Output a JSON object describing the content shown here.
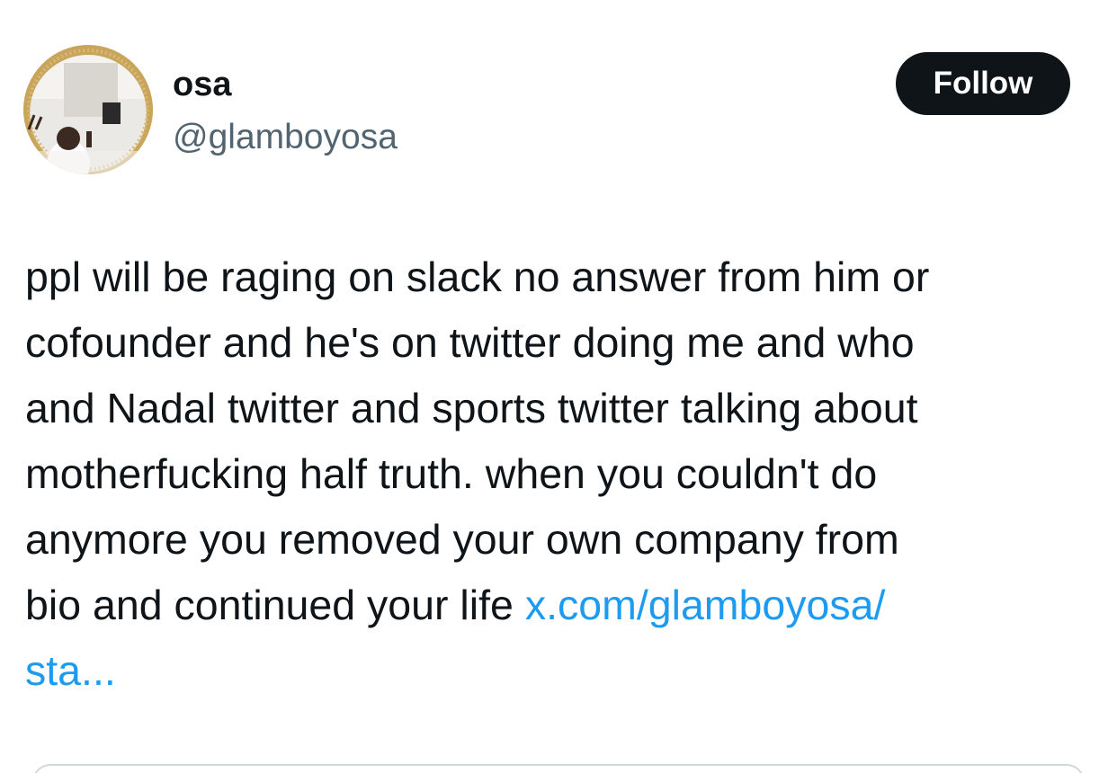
{
  "author": {
    "display_name": "osa",
    "handle": "@glamboyosa",
    "avatar_icon": "profile-photo"
  },
  "follow_button": {
    "label": "Follow"
  },
  "tweet": {
    "text_lines": [
      "ppl will be raging on slack no answer from him or",
      "cofounder and he's on twitter doing me and who",
      "and Nadal twitter and sports twitter talking about",
      "motherfucking half truth. when you couldn't do",
      "anymore you removed your own company from",
      "bio and continued your life "
    ],
    "link_line1": "x.com/glamboyosa/",
    "link_line2": "sta..."
  },
  "colors": {
    "text": "#0f1419",
    "secondary": "#536471",
    "link": "#1d9bf0",
    "button_bg": "#0f1419"
  }
}
